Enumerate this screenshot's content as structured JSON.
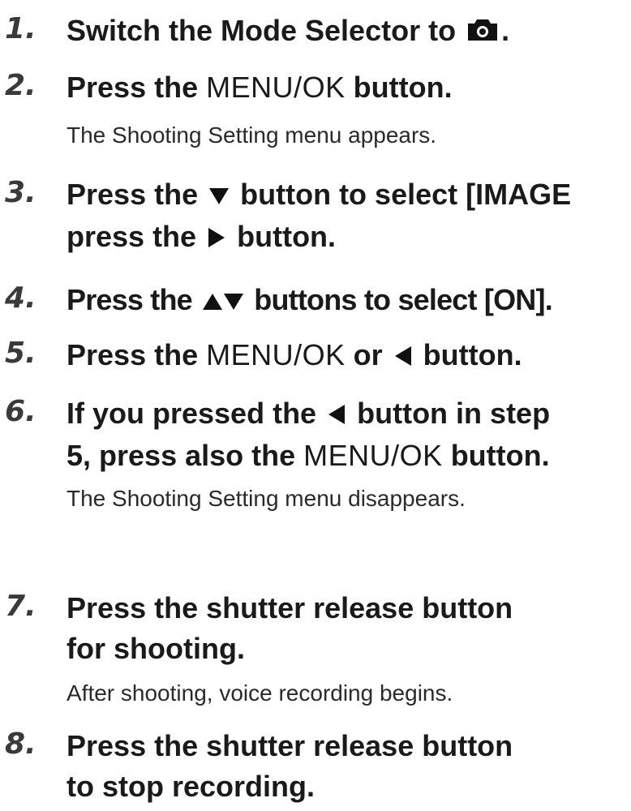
{
  "steps": [
    {
      "number": "1.",
      "text_before": "Switch the Mode Selector to",
      "icon": "camera-icon",
      "text_after": "."
    },
    {
      "number": "2.",
      "text_before": "Press the",
      "menu_label": "MENU/OK",
      "text_after": "button.",
      "description": "The Shooting Setting menu appears."
    },
    {
      "number": "3.",
      "line1_before": "Press the",
      "icon1": "down-arrow-icon",
      "line1_after": "button to select [IMAGE",
      "line2_before": "press the",
      "icon2": "right-arrow-icon",
      "line2_after": "button."
    },
    {
      "number": "4.",
      "text_before": "Press the",
      "icon": "up-down-arrows-icon",
      "text_after": "buttons to select [ON]."
    },
    {
      "number": "5.",
      "text_before": "Press the",
      "menu_label": "MENU/OK",
      "text_middle": "or",
      "icon": "left-arrow-icon",
      "text_after": "button."
    },
    {
      "number": "6.",
      "line1_before": "If you pressed the",
      "icon": "left-arrow-icon",
      "line1_after": "button in step",
      "line2_before": "5, press also the",
      "menu_label": "MENU/OK",
      "line2_after": "button.",
      "description": "The Shooting Setting menu disappears."
    },
    {
      "number": "7.",
      "line1": "Press the shutter release button",
      "line2": "for shooting.",
      "description": "After shooting, voice recording begins."
    },
    {
      "number": "8.",
      "line1": "Press the shutter release button",
      "line2": "to stop recording."
    }
  ]
}
